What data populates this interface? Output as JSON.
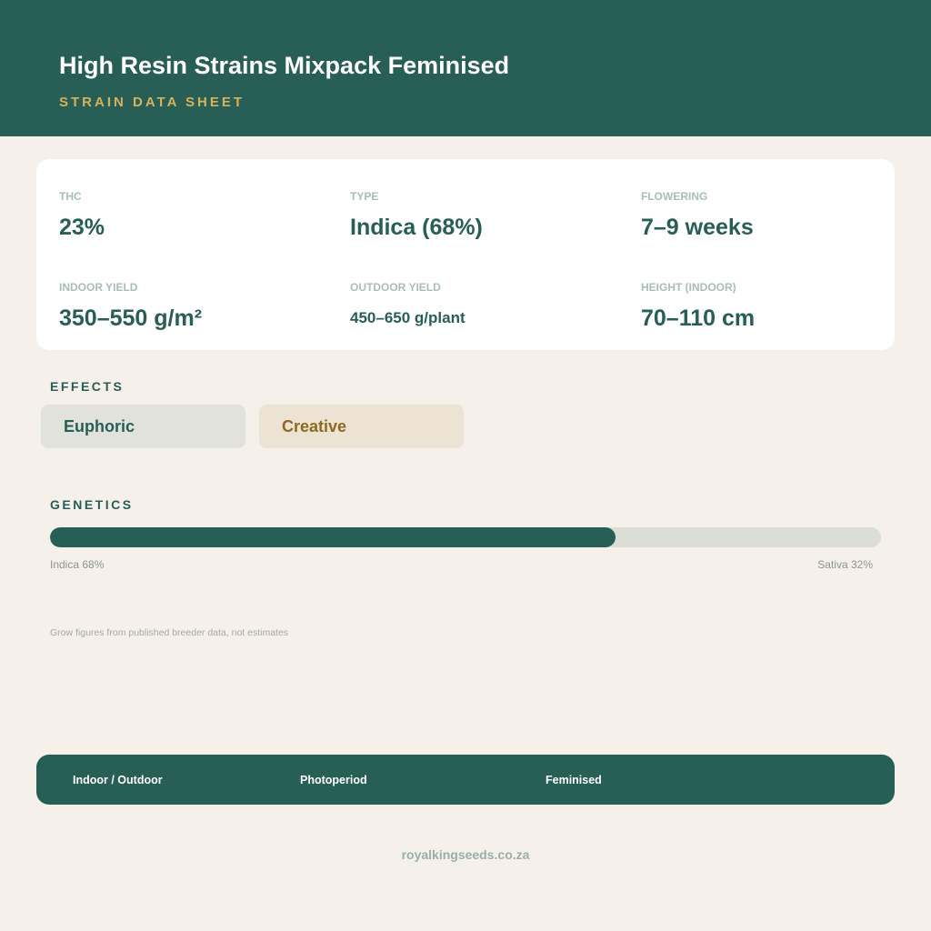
{
  "header": {
    "title": "High Resin Strains Mixpack Feminised",
    "subtitle": "STRAIN DATA SHEET"
  },
  "stats": [
    {
      "label": "THC",
      "value": "23%"
    },
    {
      "label": "TYPE",
      "value": "Indica (68%)"
    },
    {
      "label": "FLOWERING",
      "value": "7–9 weeks"
    },
    {
      "label": "INDOOR YIELD",
      "value": "350–550 g/m²"
    },
    {
      "label": "OUTDOOR YIELD",
      "value": "450–650 g/plant"
    },
    {
      "label": "HEIGHT (INDOOR)",
      "value": "70–110 cm"
    }
  ],
  "effects": {
    "heading": "EFFECTS",
    "items": [
      "Euphoric",
      "Creative"
    ]
  },
  "genetics": {
    "heading": "GENETICS",
    "indica_percent": 68,
    "sativa_percent": 32,
    "indica_label": "Indica 68%",
    "sativa_label": "Sativa 32%"
  },
  "note": "Grow figures from published breeder data, not estimates",
  "footer": {
    "items": [
      "Indoor / Outdoor",
      "Photoperiod",
      "Feminised"
    ]
  },
  "website": "royalkingseeds.co.za",
  "colors": {
    "primary": "#275e55",
    "accent": "#d6b35a",
    "background": "#f5f0ea",
    "creative_text": "#8e6a1d"
  }
}
